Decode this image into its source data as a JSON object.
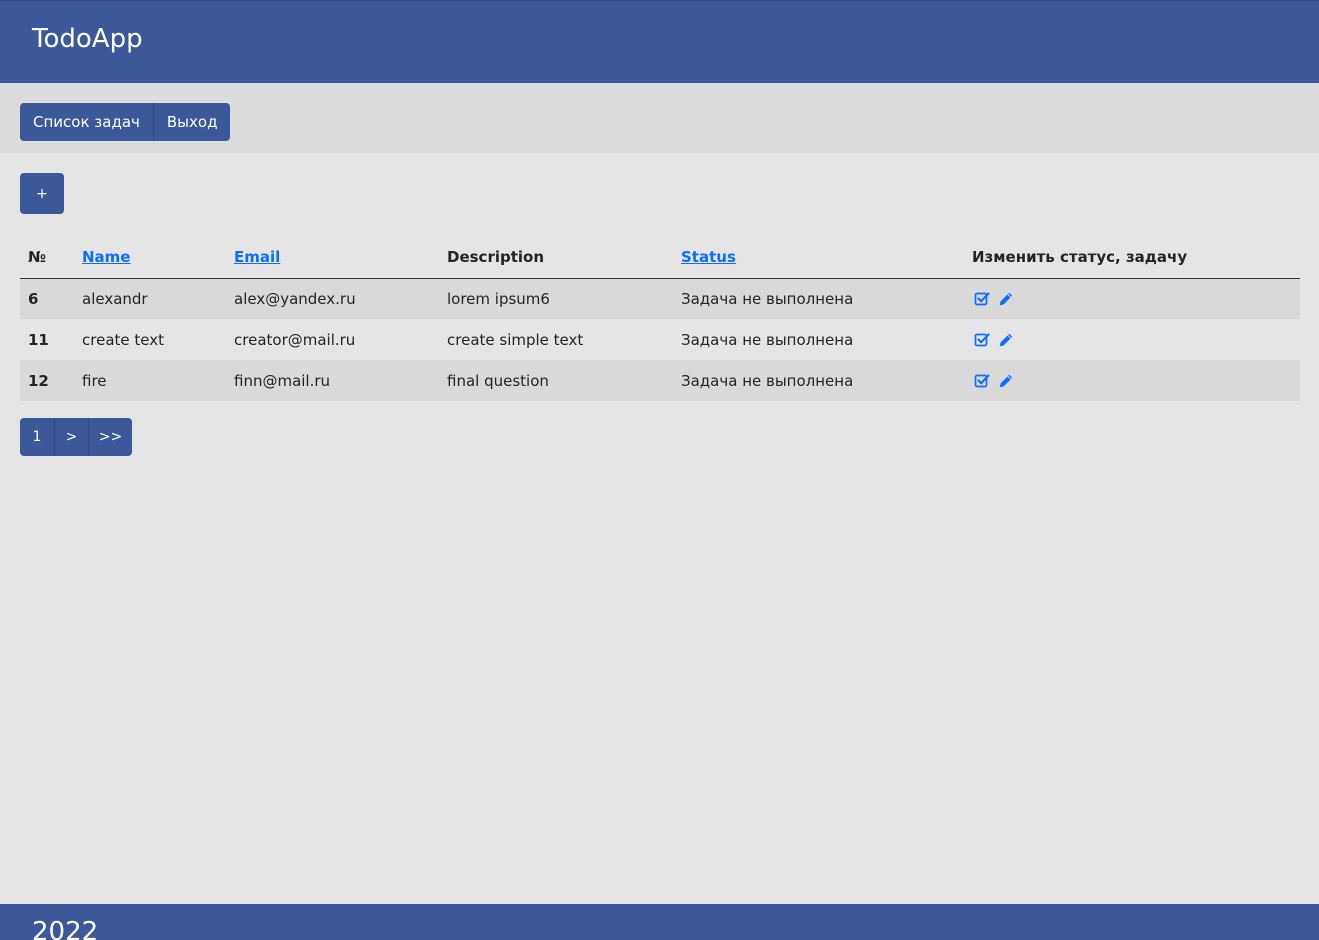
{
  "header": {
    "brand": "TodoApp"
  },
  "nav": {
    "tasks_label": "Список задач",
    "logout_label": "Выход"
  },
  "add_button_label": "+",
  "table": {
    "columns": {
      "num": "№",
      "name": "Name",
      "email": "Email",
      "description": "Description",
      "status": "Status",
      "actions": "Изменить статус, задачу"
    },
    "rows": [
      {
        "id": "6",
        "name": "alexandr",
        "email": "alex@yandex.ru",
        "description": "lorem ipsum6",
        "status": "Задача не выполнена"
      },
      {
        "id": "11",
        "name": "create text",
        "email": "creator@mail.ru",
        "description": "create simple text",
        "status": "Задача не выполнена"
      },
      {
        "id": "12",
        "name": "fire",
        "email": "finn@mail.ru",
        "description": "final question",
        "status": "Задача не выполнена"
      }
    ],
    "action_icons": [
      "check-square-icon",
      "pencil-icon"
    ]
  },
  "pagination": {
    "page": "1",
    "next": ">",
    "last": ">>"
  },
  "footer": {
    "year": "2022"
  },
  "colors": {
    "primary": "#3b5998",
    "link": "#0d6efd",
    "background": "#e5e5e5"
  }
}
